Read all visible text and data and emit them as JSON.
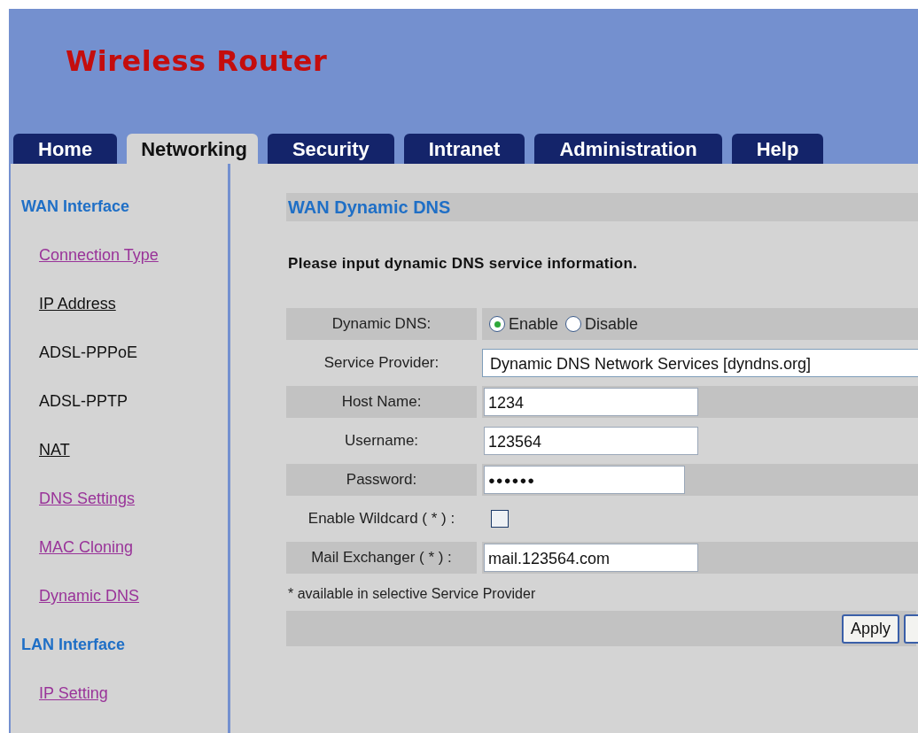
{
  "header": {
    "title": "Wireless Router"
  },
  "tabs": [
    {
      "label": "Home",
      "selected": false
    },
    {
      "label": "Networking",
      "selected": true
    },
    {
      "label": "Security",
      "selected": false
    },
    {
      "label": "Intranet",
      "selected": false
    },
    {
      "label": "Administration",
      "selected": false
    },
    {
      "label": "Help",
      "selected": false
    }
  ],
  "sidebar": {
    "sections": [
      {
        "title": "WAN Interface",
        "items": [
          {
            "label": "Connection Type",
            "kind": "visited"
          },
          {
            "label": "IP Address",
            "kind": "link"
          },
          {
            "label": "ADSL-PPPoE",
            "kind": "text"
          },
          {
            "label": "ADSL-PPTP",
            "kind": "text"
          },
          {
            "label": "NAT",
            "kind": "link"
          },
          {
            "label": "DNS Settings",
            "kind": "visited"
          },
          {
            "label": "MAC Cloning",
            "kind": "visited"
          },
          {
            "label": "Dynamic DNS",
            "kind": "visited"
          }
        ]
      },
      {
        "title": "LAN Interface",
        "items": [
          {
            "label": "IP Setting",
            "kind": "visited"
          }
        ]
      }
    ]
  },
  "main": {
    "title": "WAN Dynamic DNS",
    "instruction": "Please input dynamic DNS service information.",
    "rows": [
      {
        "label": "Dynamic DNS:",
        "kind": "radio",
        "shaded": true,
        "options": [
          {
            "label": "Enable",
            "selected": true
          },
          {
            "label": "Disable",
            "selected": false
          }
        ]
      },
      {
        "label": "Service Provider:",
        "kind": "select",
        "shaded": false,
        "value": "Dynamic DNS Network Services [dyndns.org]"
      },
      {
        "label": "Host Name:",
        "kind": "text",
        "shaded": true,
        "value": "1234"
      },
      {
        "label": "Username:",
        "kind": "text",
        "shaded": false,
        "value": "123564"
      },
      {
        "label": "Password:",
        "kind": "password",
        "shaded": true,
        "value": "●●●●●●"
      },
      {
        "label": "Enable Wildcard ( * ) :",
        "kind": "checkbox",
        "shaded": false,
        "checked": false
      },
      {
        "label": "Mail Exchanger ( * ) :",
        "kind": "text",
        "shaded": true,
        "value": "mail.123564.com"
      }
    ],
    "note": "* available in selective Service Provider",
    "buttons": [
      "Apply"
    ]
  }
}
